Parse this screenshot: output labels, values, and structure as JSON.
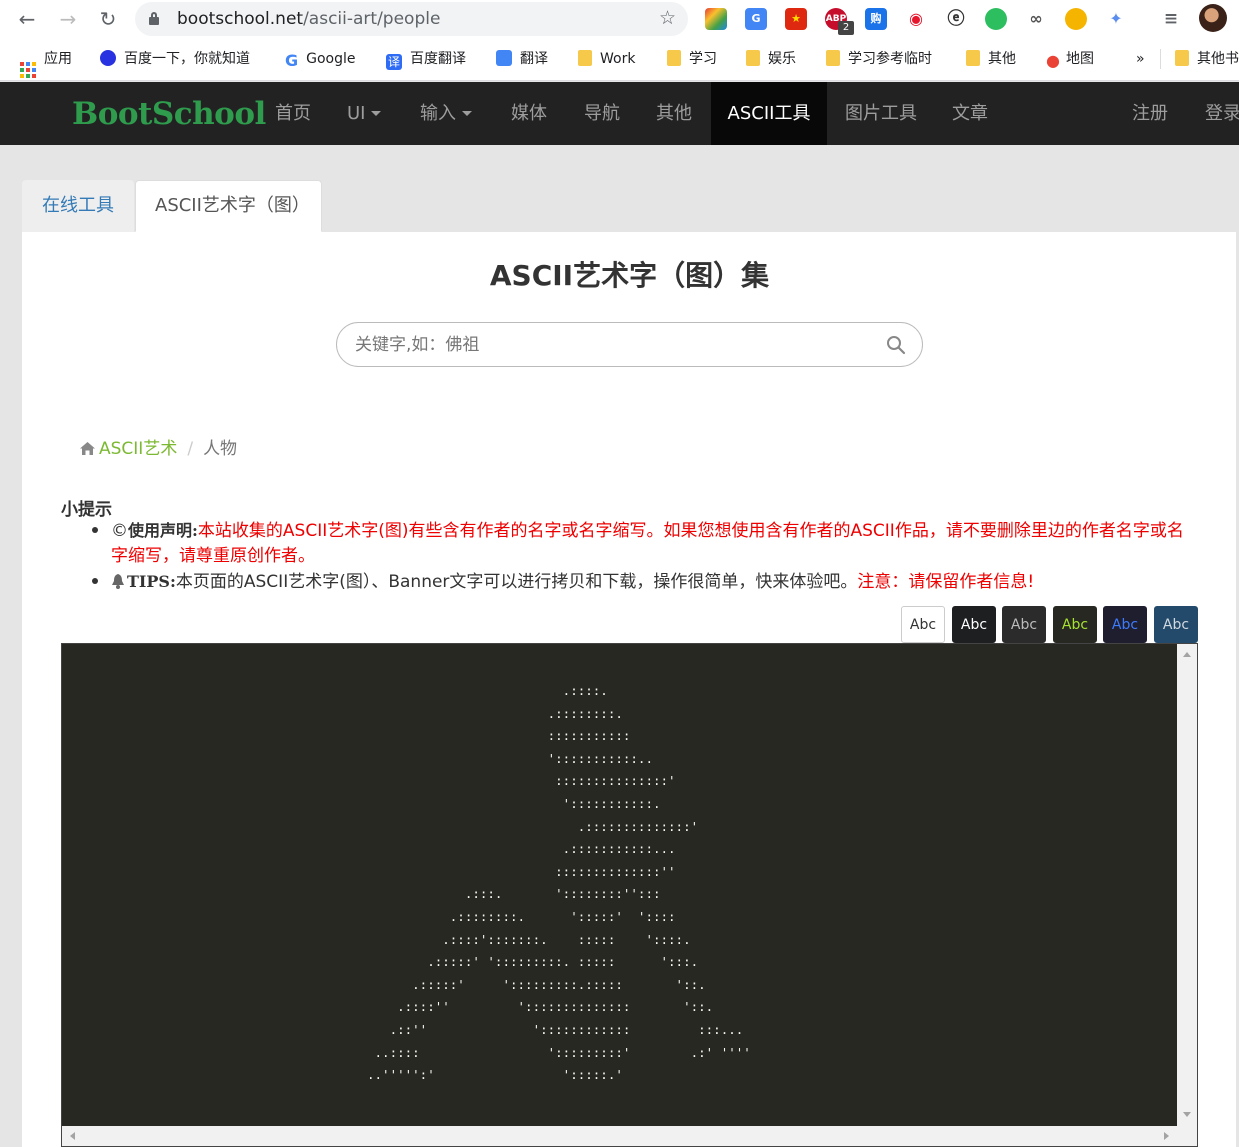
{
  "browser": {
    "url_host": "bootschool.net",
    "url_path": "/ascii-art/people",
    "ext_badge": "2",
    "bookmarks": [
      {
        "label": "应用",
        "icon": "apps-icon"
      },
      {
        "label": "百度一下，你就知道",
        "icon": "baidu-icon"
      },
      {
        "label": "Google",
        "icon": "google-icon"
      },
      {
        "label": "百度翻译",
        "icon": "baidu-translate-icon"
      },
      {
        "label": "翻译",
        "icon": "google-translate-icon"
      },
      {
        "label": "Work",
        "icon": "folder-icon"
      },
      {
        "label": "学习",
        "icon": "folder-icon"
      },
      {
        "label": "娱乐",
        "icon": "folder-icon"
      },
      {
        "label": "学习参考临时",
        "icon": "folder-icon"
      },
      {
        "label": "其他",
        "icon": "folder-icon"
      },
      {
        "label": "地图",
        "icon": "maps-pin-icon"
      }
    ],
    "more_bookmarks": "»",
    "other_bookmarks": "其他书签"
  },
  "navbar": {
    "brand": "BootSchool",
    "items": [
      {
        "label": "首页",
        "dropdown": false,
        "active": false
      },
      {
        "label": "UI",
        "dropdown": true,
        "active": false
      },
      {
        "label": "输入",
        "dropdown": true,
        "active": false
      },
      {
        "label": "媒体",
        "dropdown": false,
        "active": false
      },
      {
        "label": "导航",
        "dropdown": false,
        "active": false
      },
      {
        "label": "其他",
        "dropdown": false,
        "active": false
      },
      {
        "label": "ASCII工具",
        "dropdown": false,
        "active": true
      },
      {
        "label": "图片工具",
        "dropdown": false,
        "active": false
      },
      {
        "label": "文章",
        "dropdown": false,
        "active": false
      }
    ],
    "register": "注册",
    "login": "登录"
  },
  "tabs": {
    "online_tools": "在线工具",
    "ascii_art": "ASCII艺术字（图）"
  },
  "page": {
    "title": "ASCII艺术字（图）集",
    "search_placeholder": "关键字,如：佛祖"
  },
  "breadcrumb": {
    "home": "ASCII艺术",
    "current": "人物",
    "separator": "/"
  },
  "tips": {
    "title": "小提示",
    "item1_symbol": "©",
    "item1_label": "使用声明:",
    "item1_text": "本站收集的ASCII艺术字(图)有些含有作者的名字或名字缩写。如果您想使用含有作者的ASCII作品，请不要删除里边的作者名字或名字缩写，请尊重原创作者。",
    "item2_label": "TIPS:",
    "item2_text": "本页面的ASCII艺术字(图）、Banner文字可以进行拷贝和下载，操作很简单，快来体验吧。",
    "item2_notice": "注意：请保留作者信息!"
  },
  "themes": [
    {
      "label": "Abc",
      "bg": "#ffffff",
      "fg": "#333333",
      "border": "#cccccc"
    },
    {
      "label": "Abc",
      "bg": "#1d1f21",
      "fg": "#ffffff",
      "border": "#1d1f21"
    },
    {
      "label": "Abc",
      "bg": "#2b2b2b",
      "fg": "#bbbbbb",
      "border": "#2b2b2b"
    },
    {
      "label": "Abc",
      "bg": "#272822",
      "fg": "#a6e22e",
      "border": "#272822"
    },
    {
      "label": "Abc",
      "bg": "#1e1e2e",
      "fg": "#3d7bfd",
      "border": "#1e1e2e"
    },
    {
      "label": "Abc",
      "bg": "#234a6b",
      "fg": "#d0d8e0",
      "border": "#234a6b"
    }
  ],
  "ascii_art": "                          .::::.\n                        .::::::::.\n                        :::::::::::\n                        ':::::::::::..\n                         :::::::::::::::'\n                          ':::::::::::.\n                            .::::::::::::::'\n                          .:::::::::::...\n                         ::::::::::::::''\n             .:::.       '::::::::'':::\n           .::::::::.      ':::::'  '::::\n          .::::':::::::.    :::::    '::::.\n        .:::::' ':::::::::. :::::      ':::.\n      .:::::'     ':::::::::.:::::       '::.\n    .::::''         '::::::::::::::       '::.\n   .::''              '::::::::::::         :::...\n ..::::                 ':::::::::'        .:' ''''\n..''''':'                 ':::::.'"
}
